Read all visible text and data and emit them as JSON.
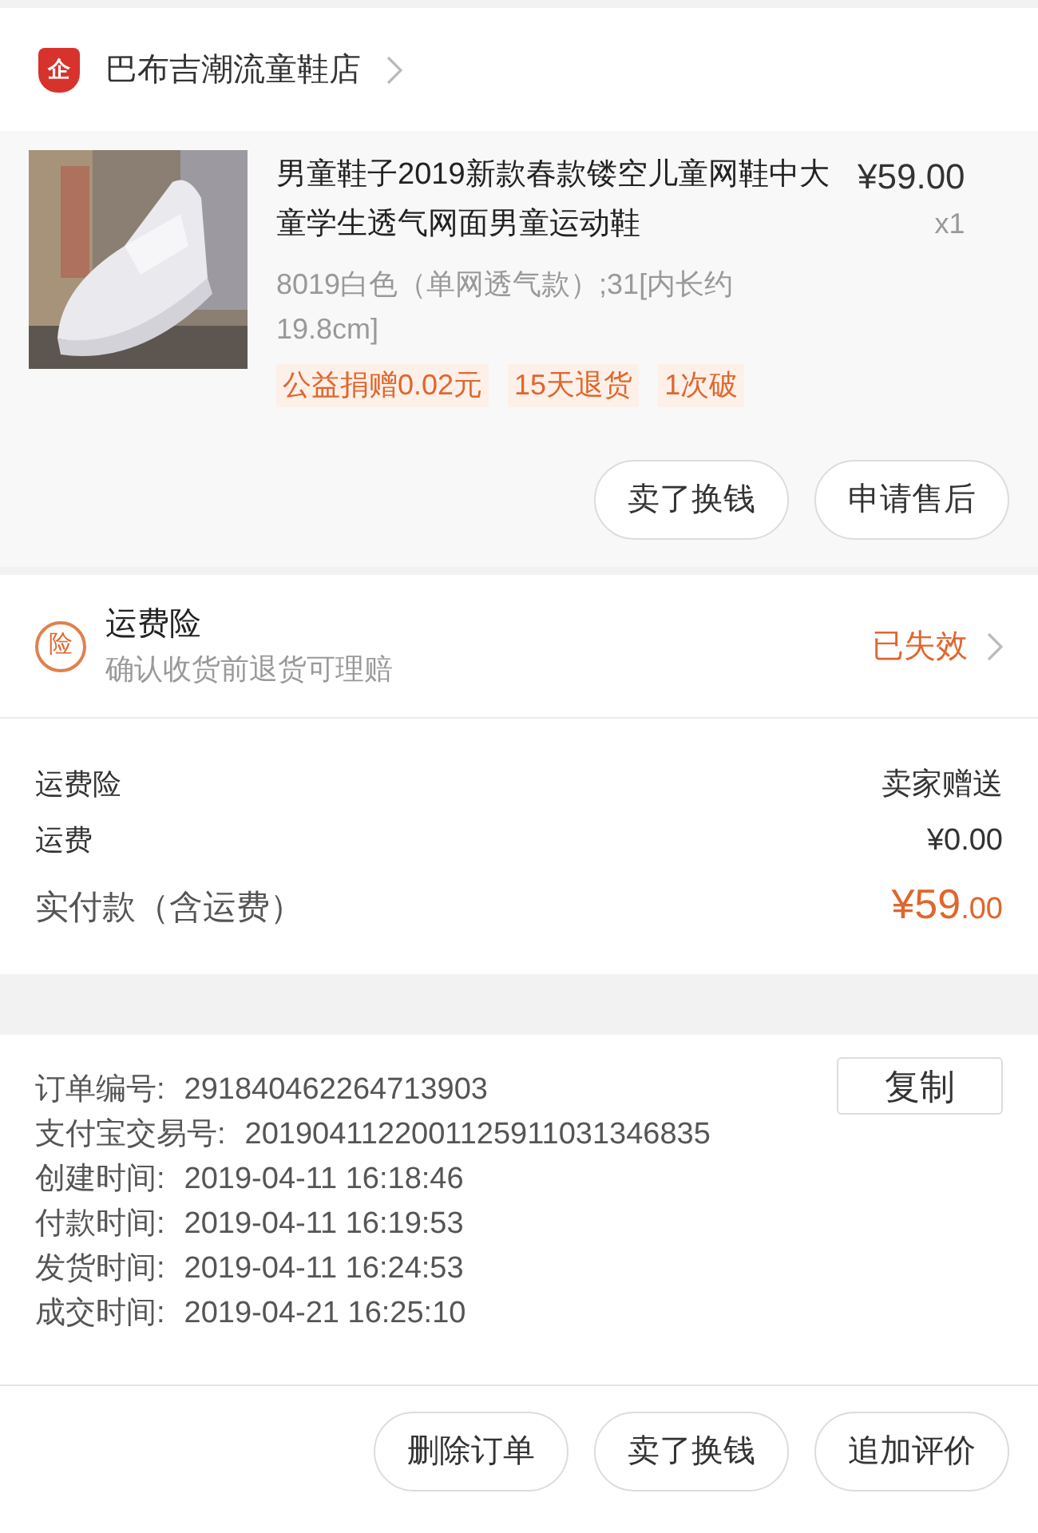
{
  "shop": {
    "name": "巴布吉潮流童鞋店",
    "badge": "企"
  },
  "product": {
    "image": {
      "kind": "picture"
    },
    "title": "男童鞋子2019新款春款镂空儿童网鞋中大童学生透气网面男童运动鞋",
    "price": "¥59.00",
    "quantity": "x1",
    "spec": "8019白色（单网透气款）;31[内长约19.8cm]",
    "tags": [
      "公益捐赠0.02元",
      "15天退货",
      "1次破"
    ],
    "buttons": [
      "卖了换钱",
      "申请售后"
    ]
  },
  "insurance": {
    "badge": "险",
    "title": "运费险",
    "subtitle": "确认收货前退货可理赔",
    "status": "已失效"
  },
  "costs": [
    {
      "label": "运费险",
      "value": "卖家赠送",
      "kind": "plain"
    },
    {
      "label": "运费",
      "value": "¥0.00",
      "kind": "plain"
    },
    {
      "label": "实付款（含运费）",
      "value": "¥59",
      "cents": ".00",
      "kind": "total"
    }
  ],
  "order_info": {
    "copy_button": "复制",
    "rows": [
      {
        "label": "订单编号:",
        "value": "291840462264713903"
      },
      {
        "label": "支付宝交易号:",
        "value": "2019041122001125911031346835"
      },
      {
        "label": "创建时间:",
        "value": "2019-04-11 16:18:46"
      },
      {
        "label": "付款时间:",
        "value": "2019-04-11 16:19:53"
      },
      {
        "label": "发货时间:",
        "value": "2019-04-11 16:24:53"
      },
      {
        "label": "成交时间:",
        "value": "2019-04-21 16:25:10"
      }
    ]
  },
  "bottom_buttons": [
    "删除订单",
    "卖了换钱",
    "追加评价"
  ]
}
